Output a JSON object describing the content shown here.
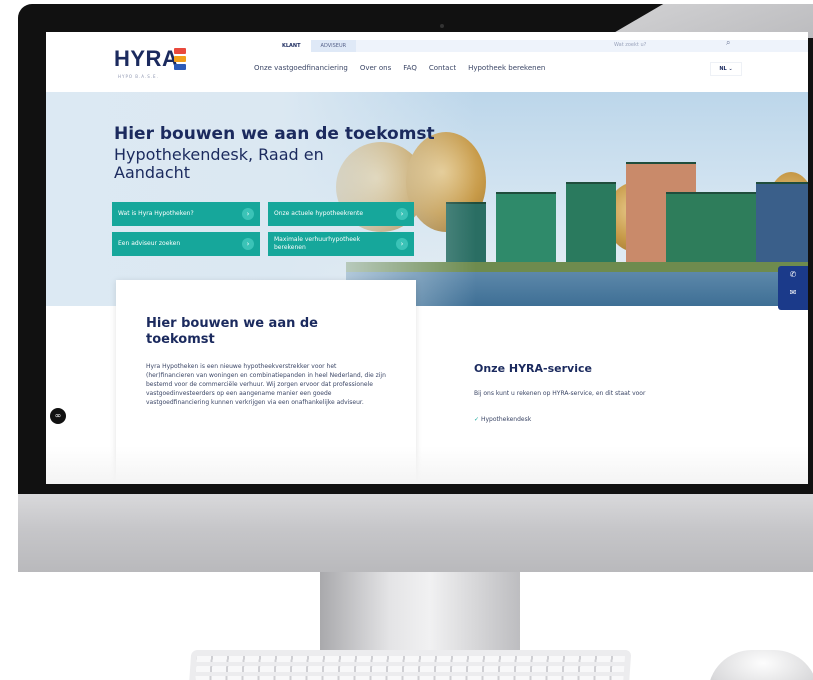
{
  "header": {
    "logo_text": "HYRA",
    "logo_tagline": "HYPO  B.A.S.E.",
    "tabs": [
      "KLANT",
      "ADVISEUR"
    ],
    "search_placeholder": "Wat zoekt u?",
    "nav": [
      "Onze vastgoedfinanciering",
      "Over ons",
      "FAQ",
      "Contact",
      "Hypotheek berekenen"
    ],
    "language": "NL ⌄"
  },
  "hero": {
    "title": "Hier bouwen we aan de toekomst",
    "subtitle": "Hypothekendesk, Raad en Aandacht",
    "buttons": [
      "Wat is Hyra Hypotheken?",
      "Onze actuele hypotheekrente",
      "Een adviseur zoeken",
      "Maximale verhuurhypotheek berekenen"
    ]
  },
  "card": {
    "title": "Hier bouwen we aan de toekomst",
    "body": "Hyra Hypotheken is een nieuwe hypotheekverstrekker voor het (her)financieren van woningen en combinatiepanden in heel Nederland, die zijn bestemd voor de commerciële verhuur. Wij zorgen ervoor dat professionele vastgoedinvesteerders op een aangename manier een goede vastgoedfinanciering kunnen verkrijgen via een onafhankelijke adviseur."
  },
  "service": {
    "title": "Onze HYRA-service",
    "text": "Bij ons kunt u rekenen op HYRA-service, en dit staat voor",
    "check_item": "Hypothekendesk"
  },
  "brand": {
    "accent": "#16a79b",
    "navy": "#1b2a5e"
  }
}
